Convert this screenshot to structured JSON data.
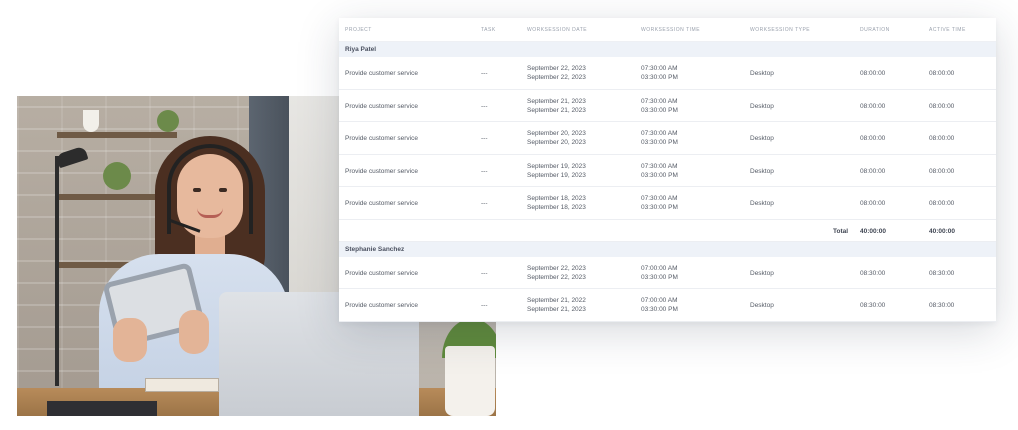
{
  "columns": {
    "project": "PROJECT",
    "task": "TASK",
    "date": "WORKSESSION DATE",
    "time": "WORKSESSION TIME",
    "type": "WORKSESSION TYPE",
    "duration": "DURATION",
    "active": "ACTIVE TIME"
  },
  "groups": [
    {
      "name": "Riya Patel",
      "rows": [
        {
          "project": "Provide customer service",
          "task": "---",
          "date_start": "September 22, 2023",
          "date_end": "September 22, 2023",
          "time_start": "07:30:00 AM",
          "time_end": "03:30:00 PM",
          "type": "Desktop",
          "duration": "08:00:00",
          "active": "08:00:00"
        },
        {
          "project": "Provide customer service",
          "task": "---",
          "date_start": "September 21, 2023",
          "date_end": "September 21, 2023",
          "time_start": "07:30:00 AM",
          "time_end": "03:30:00 PM",
          "type": "Desktop",
          "duration": "08:00:00",
          "active": "08:00:00"
        },
        {
          "project": "Provide customer service",
          "task": "---",
          "date_start": "September 20, 2023",
          "date_end": "September 20, 2023",
          "time_start": "07:30:00 AM",
          "time_end": "03:30:00 PM",
          "type": "Desktop",
          "duration": "08:00:00",
          "active": "08:00:00"
        },
        {
          "project": "Provide customer service",
          "task": "---",
          "date_start": "September 19, 2023",
          "date_end": "September 19, 2023",
          "time_start": "07:30:00 AM",
          "time_end": "03:30:00 PM",
          "type": "Desktop",
          "duration": "08:00:00",
          "active": "08:00:00"
        },
        {
          "project": "Provide customer service",
          "task": "---",
          "date_start": "September 18, 2023",
          "date_end": "September 18, 2023",
          "time_start": "07:30:00 AM",
          "time_end": "03:30:00 PM",
          "type": "Desktop",
          "duration": "08:00:00",
          "active": "08:00:00"
        }
      ],
      "total_label": "Total",
      "total_duration": "40:00:00",
      "total_active": "40:00:00"
    },
    {
      "name": "Stephanie Sanchez",
      "rows": [
        {
          "project": "Provide customer service",
          "task": "---",
          "date_start": "September 22, 2023",
          "date_end": "September 22, 2023",
          "time_start": "07:00:00 AM",
          "time_end": "03:30:00 PM",
          "type": "Desktop",
          "duration": "08:30:00",
          "active": "08:30:00"
        },
        {
          "project": "Provide customer service",
          "task": "---",
          "date_start": "September 21, 2022",
          "date_end": "September 21, 2023",
          "time_start": "07:00:00 AM",
          "time_end": "03:30:00 PM",
          "type": "Desktop",
          "duration": "08:30:00",
          "active": "08:30:00"
        }
      ]
    }
  ]
}
